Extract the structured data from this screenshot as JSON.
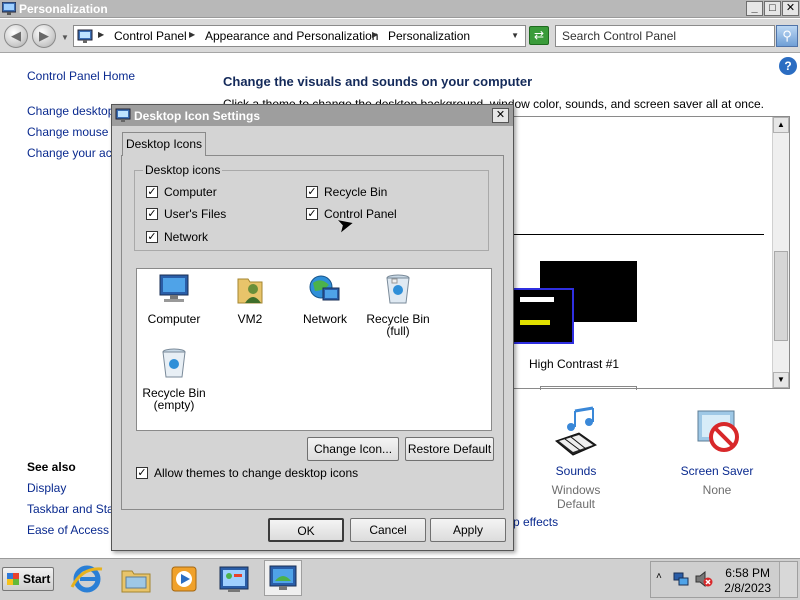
{
  "window": {
    "title": "Personalization",
    "controls": {
      "minimize": "_",
      "maximize": "□",
      "close": "✕"
    }
  },
  "address": {
    "crumbs": [
      "Control Panel",
      "Appearance and Personalization",
      "Personalization"
    ],
    "search_placeholder": "Search Control Panel"
  },
  "help_icon": "?",
  "left_pane": {
    "home": "Control Panel Home",
    "links": [
      "Change desktop i",
      "Change mouse po",
      "Change your acc"
    ],
    "see_also_heading": "See also",
    "see_also": [
      "Display",
      "Taskbar and Star",
      "Ease of Access C"
    ]
  },
  "main": {
    "heading": "Change the visuals and sounds on your computer",
    "subheading": "Click a theme to change the desktop background, window color, sounds, and screen saver all at once.",
    "theme_label": "High Contrast #1",
    "sounds": {
      "label": "Sounds",
      "value": "Windows Default"
    },
    "screen_saver": {
      "label": "Screen Saver",
      "value": "None"
    },
    "effects_fragment": "p effects"
  },
  "dialog": {
    "title": "Desktop Icon Settings",
    "close": "✕",
    "tab": "Desktop Icons",
    "group_label": "Desktop icons",
    "checkboxes": [
      {
        "label": "Computer",
        "checked": true
      },
      {
        "label": "User's Files",
        "checked": true
      },
      {
        "label": "Network",
        "checked": true
      },
      {
        "label": "Recycle Bin",
        "checked": true
      },
      {
        "label": "Control Panel",
        "checked": true
      }
    ],
    "icons": [
      {
        "label": "Computer",
        "icon": "computer-icon"
      },
      {
        "label": "VM2",
        "icon": "user-folder-icon"
      },
      {
        "label": "Network",
        "icon": "network-icon"
      },
      {
        "label": "Recycle Bin\n(full)",
        "icon": "recycle-bin-full-icon"
      },
      {
        "label": "Recycle Bin\n(empty)",
        "icon": "recycle-bin-empty-icon"
      }
    ],
    "change_icon": "Change Icon...",
    "restore_default": "Restore Default",
    "allow_themes": {
      "label": "Allow themes to change desktop icons",
      "checked": true
    },
    "ok": "OK",
    "cancel": "Cancel",
    "apply": "Apply"
  },
  "taskbar": {
    "start": "Start",
    "time": "6:58 PM",
    "date": "2/8/2023"
  }
}
